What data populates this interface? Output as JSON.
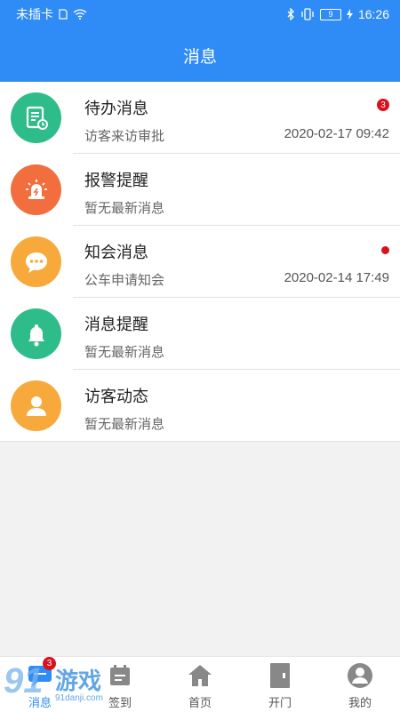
{
  "status_bar": {
    "carrier": "未插卡",
    "battery": "9",
    "time": "16:26"
  },
  "header": {
    "title": "消息"
  },
  "messages": [
    {
      "title": "待办消息",
      "subtitle": "访客来访审批",
      "time": "2020-02-17 09:42",
      "badge": "3",
      "color": "#2ebd8a",
      "icon": "todo-icon"
    },
    {
      "title": "报警提醒",
      "subtitle": "暂无最新消息",
      "time": "",
      "badge": "",
      "color": "#f26e3f",
      "icon": "alarm-icon"
    },
    {
      "title": "知会消息",
      "subtitle": "公车申请知会",
      "time": "2020-02-14 17:49",
      "badge": "dot",
      "color": "#f7a93b",
      "icon": "chat-icon"
    },
    {
      "title": "消息提醒",
      "subtitle": "暂无最新消息",
      "time": "",
      "badge": "",
      "color": "#2ebd8a",
      "icon": "bell-icon"
    },
    {
      "title": "访客动态",
      "subtitle": "暂无最新消息",
      "time": "",
      "badge": "",
      "color": "#f7a93b",
      "icon": "person-icon"
    }
  ],
  "tabs": [
    {
      "label": "消息",
      "icon": "message-icon",
      "badge": "3",
      "active": true
    },
    {
      "label": "签到",
      "icon": "checkin-icon"
    },
    {
      "label": "首页",
      "icon": "home-icon"
    },
    {
      "label": "开门",
      "icon": "door-icon"
    },
    {
      "label": "我的",
      "icon": "user-icon"
    }
  ],
  "watermark": {
    "logo": "91",
    "brand": "游戏",
    "domain": "91danji.com"
  },
  "colors": {
    "primary": "#2f8bf5",
    "badge": "#d9111c"
  }
}
